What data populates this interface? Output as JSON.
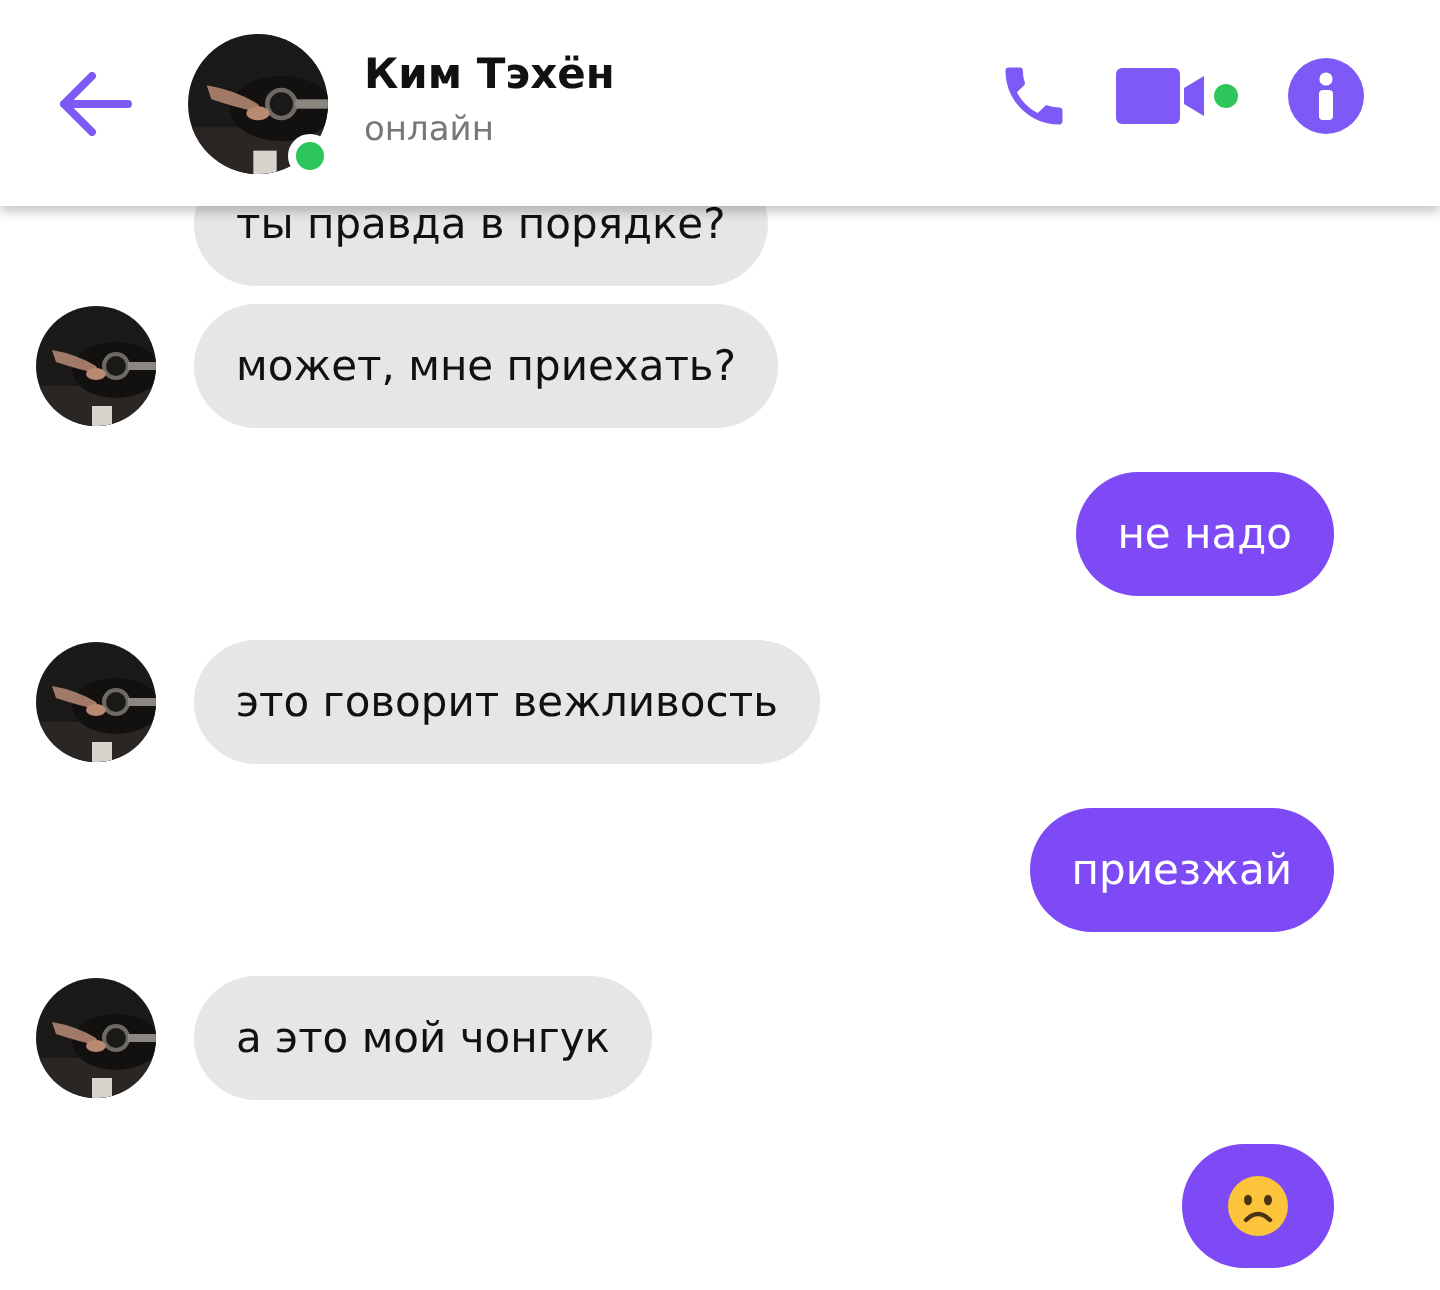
{
  "header": {
    "contact_name": "Ким Тэхён",
    "status": "онлайн",
    "online": true
  },
  "messages": [
    {
      "outgoing": false,
      "kind": "text",
      "text": "ты правда в порядке?",
      "avatar": false
    },
    {
      "outgoing": false,
      "kind": "text",
      "text": "может, мне приехать?",
      "avatar": true
    },
    {
      "outgoing": true,
      "kind": "text",
      "text": "не надо",
      "avatar": false
    },
    {
      "outgoing": false,
      "kind": "text",
      "text": "это говорит вежливость",
      "avatar": true
    },
    {
      "outgoing": true,
      "kind": "text",
      "text": "приезжай",
      "avatar": false
    },
    {
      "outgoing": false,
      "kind": "text",
      "text": "а это мой чонгук",
      "avatar": true
    },
    {
      "outgoing": true,
      "kind": "emoji",
      "avatar": false
    }
  ]
}
